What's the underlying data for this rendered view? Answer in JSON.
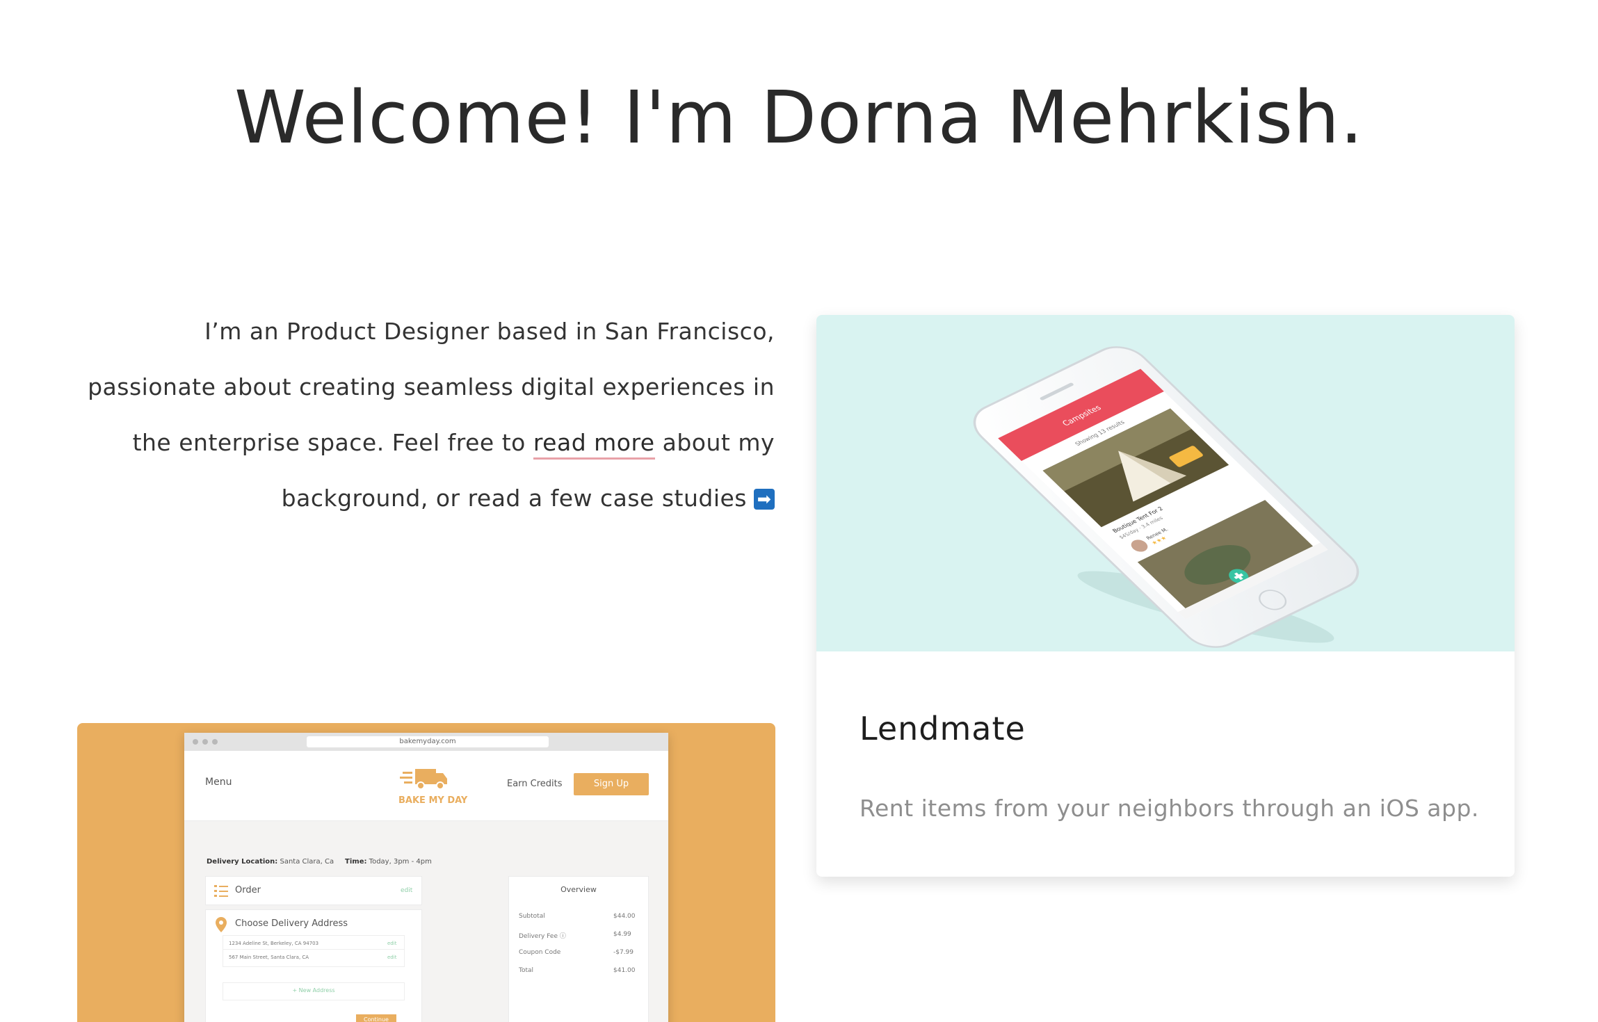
{
  "header": {
    "title": "Welcome! I'm Dorna Mehrkish."
  },
  "intro": {
    "text_before_link": "I’m an Product Designer based in San Francisco, passionate about creating seamless digital experiences in the enterprise space. Feel free to ",
    "link_text": "read more",
    "text_after_link": " about my background, or read a few case studies",
    "arrow": "➡",
    "link_underline_color": "#e8a1a8"
  },
  "projects": [
    {
      "title": "Lendmate",
      "description": "Rent items from your neighbors through an iOS app.",
      "background_color": "#d9f3f1",
      "phone_screen": {
        "header_title": "Campsites",
        "results_text": "Showing 13 results",
        "item_title": "Boutique Tent For 2",
        "item_price": "$45/day",
        "item_meta": "$45/day · 3.4 miles",
        "owner_name": "Renee M.",
        "accent_color": "#ea4d5c"
      }
    },
    {
      "title": "Bake My Day",
      "background_color": "#e9ae5f",
      "screenshot": {
        "url": "bakemyday.com",
        "menu": "Menu",
        "logo_text": "BAKE MY DAY",
        "earn_credits": "Earn Credits",
        "sign_up": "Sign Up",
        "delivery_location_label": "Delivery Location:",
        "delivery_location_value": "Santa Clara, Ca",
        "time_label": "Time:",
        "time_value": "Today, 3pm - 4pm",
        "order_label": "Order",
        "order_edit": "edit",
        "choose_address": "Choose Delivery Address",
        "address_1": "1234 Adeline St, Berkeley, CA 94703",
        "address_2": "567 Main Street, Santa Clara, CA",
        "address_edit": "edit",
        "new_address": "+ New Address",
        "continue": "Continue",
        "overview": {
          "title": "Overview",
          "rows": [
            {
              "label": "Subtotal",
              "value": "$44.00"
            },
            {
              "label": "Delivery Fee ⓘ",
              "value": "$4.99"
            },
            {
              "label": "Coupon Code",
              "value": "-$7.99"
            },
            {
              "label": "Total",
              "value": "$41.00"
            }
          ]
        }
      }
    }
  ]
}
